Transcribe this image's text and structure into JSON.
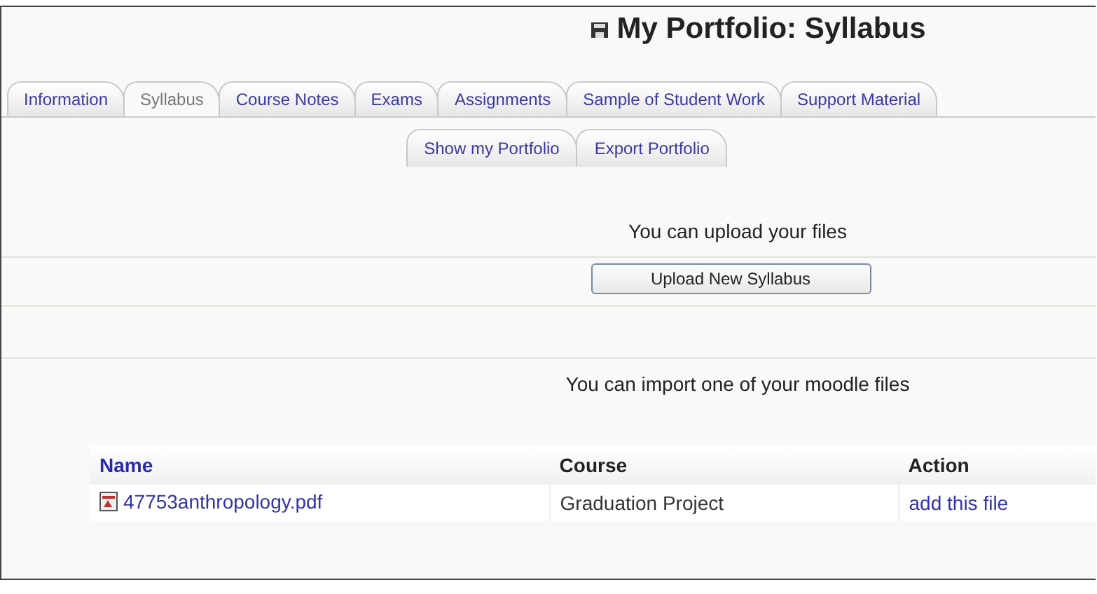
{
  "title": "My Portfolio: Syllabus",
  "tabs": [
    {
      "label": "Information",
      "selected": false
    },
    {
      "label": "Syllabus",
      "selected": true
    },
    {
      "label": "Course Notes",
      "selected": false
    },
    {
      "label": "Exams",
      "selected": false
    },
    {
      "label": "Assignments",
      "selected": false
    },
    {
      "label": "Sample of Student Work",
      "selected": false
    },
    {
      "label": "Support Material",
      "selected": false
    }
  ],
  "subtabs": [
    {
      "label": "Show my Portfolio",
      "selected": false
    },
    {
      "label": "Export Portfolio",
      "selected": false
    }
  ],
  "upload_text": "You can upload your files",
  "upload_button": "Upload New Syllabus",
  "import_text": "You can import one of your moodle files",
  "table": {
    "columns": [
      {
        "label": "Name",
        "kind": "link"
      },
      {
        "label": "Course",
        "kind": "plain"
      },
      {
        "label": "Action",
        "kind": "plain"
      }
    ],
    "rows": [
      {
        "name": "47753anthropology.pdf",
        "course": "Graduation Project",
        "action": "add this file"
      }
    ]
  }
}
